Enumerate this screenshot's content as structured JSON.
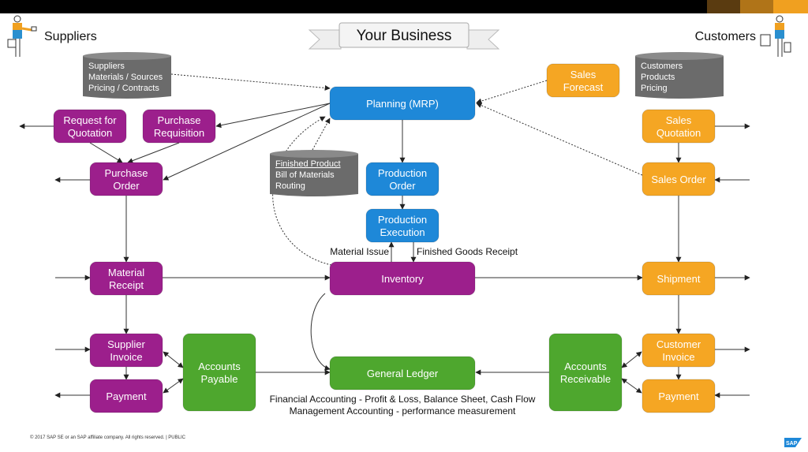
{
  "header": {
    "title": "Your Business",
    "left_party": "Suppliers",
    "right_party": "Customers"
  },
  "colors": {
    "process_purple": "#9c1f8c",
    "planning_blue": "#1e88d8",
    "sales_orange": "#f5a623",
    "finance_green": "#4ea72e",
    "master_data_gray": "#6b6b6b"
  },
  "nodes": {
    "planning": {
      "lines": [
        "Planning (MRP)"
      ]
    },
    "rfq": {
      "lines": [
        "Request for",
        "Quotation"
      ]
    },
    "purchase_requisition": {
      "lines": [
        "Purchase",
        "Requisition"
      ]
    },
    "purchase_order": {
      "lines": [
        "Purchase",
        "Order"
      ]
    },
    "production_order": {
      "lines": [
        "Production",
        "Order"
      ]
    },
    "production_execution": {
      "lines": [
        "Production",
        "Execution"
      ]
    },
    "material_receipt": {
      "lines": [
        "Material",
        "Receipt"
      ]
    },
    "inventory": {
      "lines": [
        "Inventory"
      ]
    },
    "supplier_invoice": {
      "lines": [
        "Supplier",
        "Invoice"
      ]
    },
    "payment_out": {
      "lines": [
        "Payment"
      ]
    },
    "accounts_payable": {
      "lines": [
        "Accounts",
        "Payable"
      ]
    },
    "general_ledger": {
      "lines": [
        "General Ledger"
      ]
    },
    "accounts_receivable": {
      "lines": [
        "Accounts",
        "Receivable"
      ]
    },
    "customer_invoice": {
      "lines": [
        "Customer",
        "Invoice"
      ]
    },
    "payment_in": {
      "lines": [
        "Payment"
      ]
    },
    "shipment": {
      "lines": [
        "Shipment"
      ]
    },
    "sales_order": {
      "lines": [
        "Sales Order"
      ]
    },
    "sales_quotation": {
      "lines": [
        "Sales",
        "Quotation"
      ]
    },
    "sales_forecast": {
      "lines": [
        "Sales",
        "Forecast"
      ]
    }
  },
  "master_data": {
    "suppliers": {
      "lines": [
        "Suppliers",
        "Materials / Sources",
        "Pricing / Contracts"
      ]
    },
    "customers": {
      "lines": [
        "Customers",
        "Products",
        "Pricing"
      ]
    },
    "product": {
      "lines": [
        "Finished Product",
        "Bill of Materials",
        "Routing"
      ]
    }
  },
  "labels": {
    "material_issue": "Material Issue",
    "finished_goods_receipt": "Finished Goods Receipt",
    "financial_accounting": "Financial Accounting - Profit & Loss, Balance Sheet, Cash Flow",
    "management_accounting": "Management Accounting - performance measurement"
  },
  "footer": {
    "copyright": "© 2017 SAP SE or an SAP affiliate company. All rights reserved.  |  PUBLIC",
    "logo": "SAP"
  }
}
